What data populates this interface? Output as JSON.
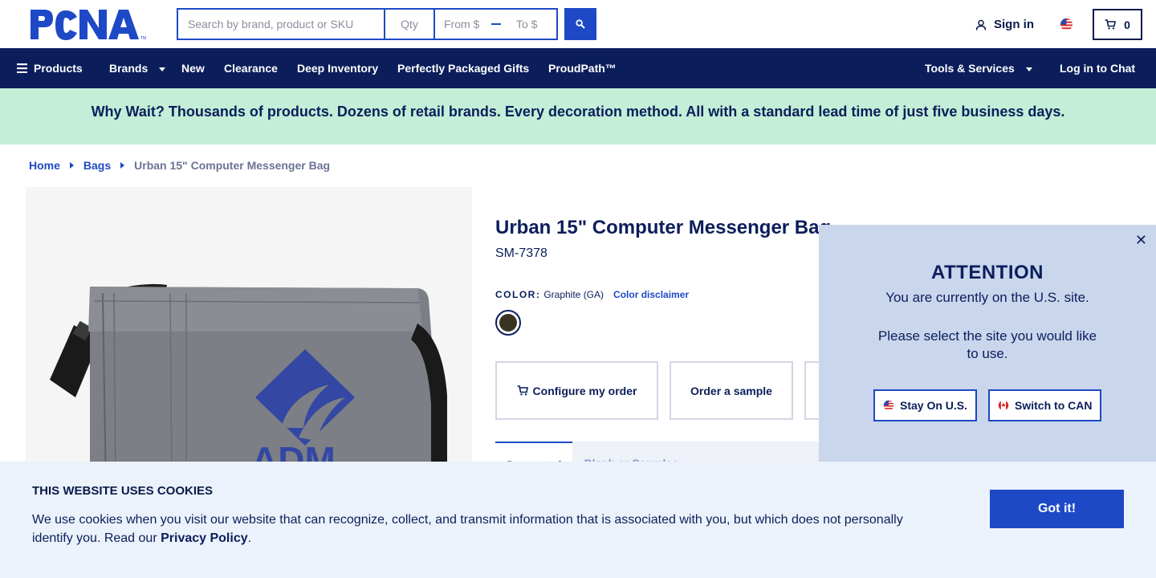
{
  "brand": {
    "logo_text": "PCNA",
    "trademark": "TM"
  },
  "search": {
    "placeholder": "Search by brand, product or SKU",
    "qty_placeholder": "Qty",
    "from_placeholder": "From $",
    "to_placeholder": "To $"
  },
  "account": {
    "sign_in_label": "Sign in",
    "cart_count": "0"
  },
  "nav": {
    "products": "Products",
    "brands": "Brands",
    "new": "New",
    "clearance": "Clearance",
    "deep_inventory": "Deep Inventory",
    "gifts": "Perfectly Packaged Gifts",
    "proudpath": "ProudPath™",
    "tools": "Tools & Services",
    "chat": "Log in to Chat"
  },
  "promo": {
    "text": "Why Wait? Thousands of products. Dozens of retail brands. Every decoration method. All with a standard lead time of just five business days."
  },
  "breadcrumb": {
    "home": "Home",
    "bags": "Bags",
    "current": "Urban 15\" Computer Messenger Bag"
  },
  "product": {
    "title": "Urban 15\" Computer Messenger Bag",
    "sku": "SM-7378",
    "color_label": "COLOR:",
    "color_value": "Graphite (GA)",
    "color_disclaimer": "Color disclaimer",
    "swatch_color": "#39341f",
    "configure_label": "Configure my order",
    "sample_label": "Order a sample",
    "imprint_text": "ADM"
  },
  "tabs": {
    "active": "Decorated",
    "inactive": "Blank or Samples"
  },
  "site_popup": {
    "title": "ATTENTION",
    "line1": "You are currently on the U.S. site.",
    "line2": "Please select the site you would like to use.",
    "stay_label": "Stay On U.S.",
    "switch_label": "Switch to CAN"
  },
  "cookie": {
    "title": "THIS WEBSITE USES COOKIES",
    "text": "We use cookies when you visit our website that can recognize, collect, and transmit information that is associated with you, but which does not personally identify you. Read our ",
    "link": "Privacy Policy",
    "period": ".",
    "button": "Got it!"
  },
  "colors": {
    "navy": "#0b1e5b",
    "accent": "#1e49c6",
    "promo_bg": "#c4eed7",
    "popup_bg": "#c9d6ec",
    "cookie_bg": "#ebf2fb"
  }
}
